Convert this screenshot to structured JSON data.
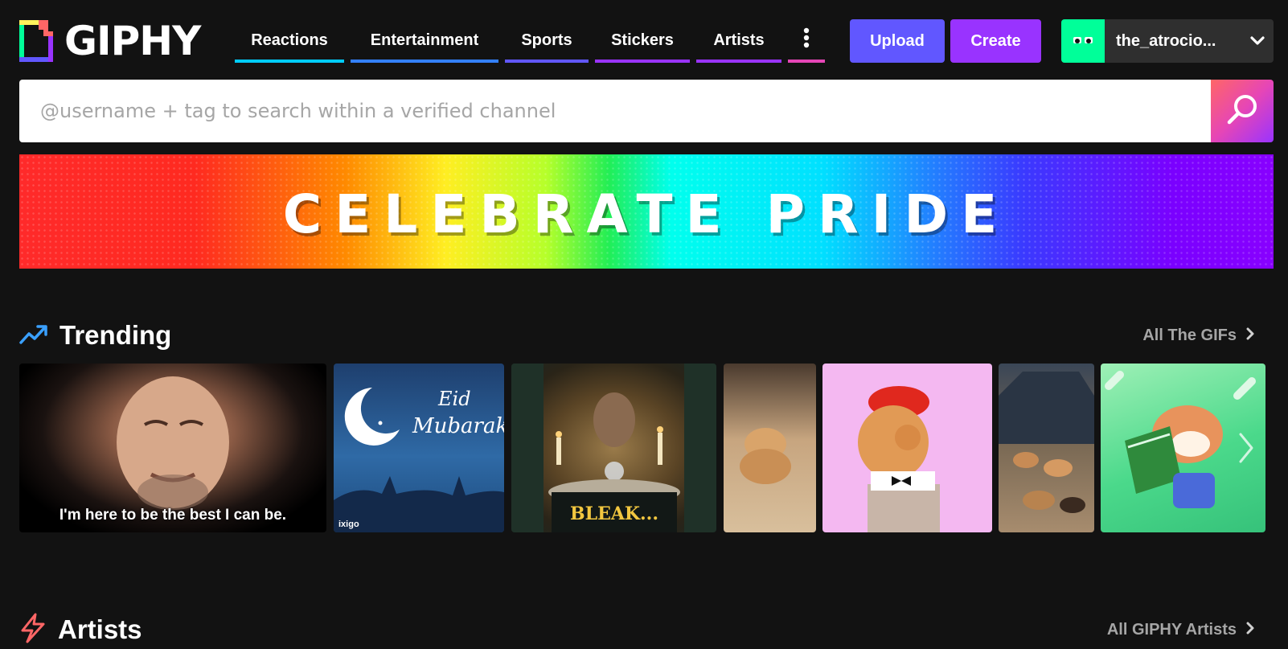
{
  "logo": {
    "text": "GIPHY"
  },
  "nav": {
    "items": [
      {
        "label": "Reactions",
        "color": "#00ccff"
      },
      {
        "label": "Entertainment",
        "color": "#3380ff"
      },
      {
        "label": "Sports",
        "color": "#6157ff"
      },
      {
        "label": "Stickers",
        "color": "#9933ff"
      },
      {
        "label": "Artists",
        "color": "#9933ff"
      }
    ],
    "more_icon": "vertical-dots-icon",
    "more_color": "#e646b6"
  },
  "actions": {
    "upload_label": "Upload",
    "create_label": "Create"
  },
  "user": {
    "name": "the_atrocio...",
    "avatar_color": "#00ff99"
  },
  "search": {
    "placeholder": "@username + tag to search within a verified channel",
    "value": ""
  },
  "banner": {
    "text": "CELEBRATE PRIDE"
  },
  "trending": {
    "title": "Trending",
    "link_label": "All The GIFs",
    "icon": "trending-arrow-icon",
    "gifs": [
      {
        "caption": "I'm here to be the best I can be."
      },
      {
        "caption": "Eid Mubarak",
        "watermark": "ixigo"
      },
      {
        "caption": "BLEAK..."
      },
      {
        "caption": ""
      },
      {
        "caption": ""
      },
      {
        "caption": ""
      },
      {
        "caption": ""
      }
    ]
  },
  "artists": {
    "title": "Artists",
    "link_label": "All GIPHY Artists",
    "icon": "lightning-bolt-icon"
  }
}
